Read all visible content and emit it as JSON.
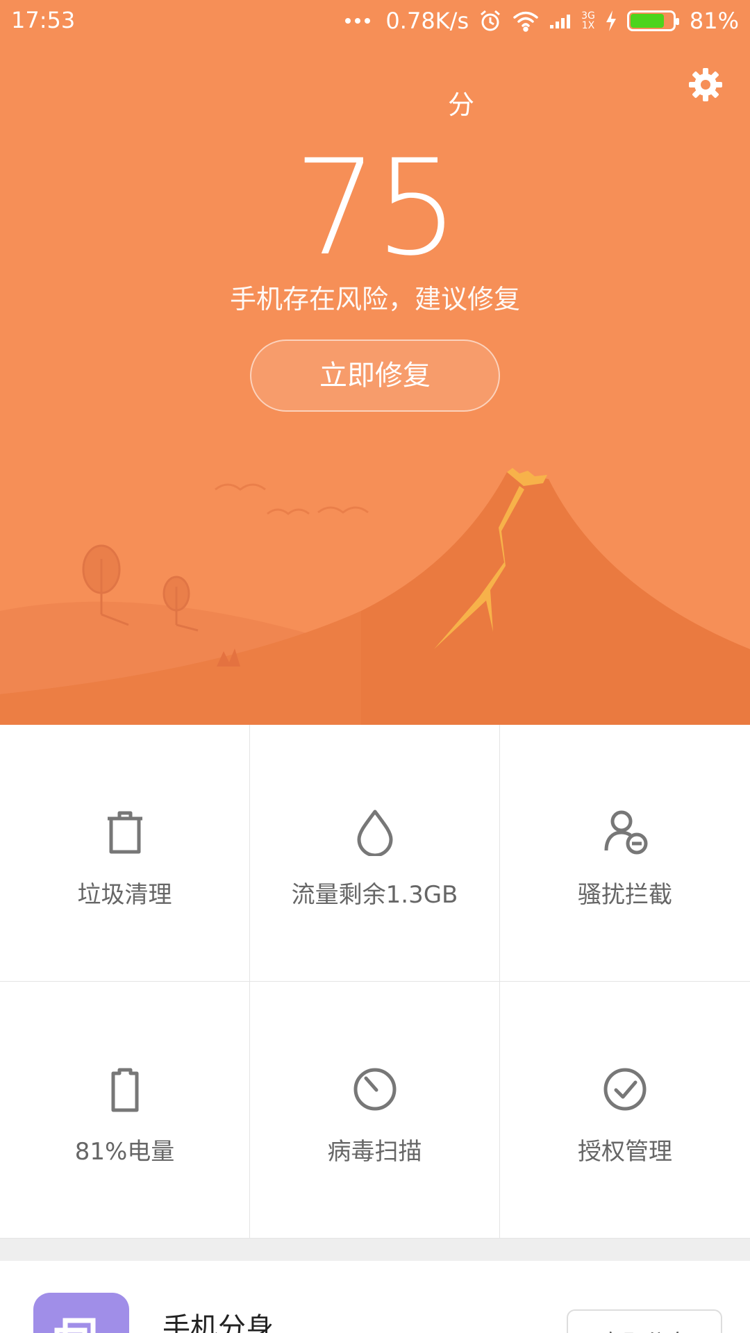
{
  "status_bar": {
    "time": "17:53",
    "net_speed": "0.78K/s",
    "net_type_top": "3G",
    "net_type_bottom": "1X",
    "battery_percent": "81%",
    "battery_level": 0.81
  },
  "hero": {
    "score": "75",
    "score_unit": "分",
    "warning": "手机存在风险，建议修复",
    "fix_button": "立即修复",
    "colors": {
      "background": "#f68f57",
      "mountain": "#ea7a40",
      "crack": "#f7b24a"
    }
  },
  "grid": {
    "items": [
      {
        "label": "垃圾清理",
        "icon": "trash-icon"
      },
      {
        "label": "流量剩余1.3GB",
        "icon": "droplet-icon"
      },
      {
        "label": "骚扰拦截",
        "icon": "block-user-icon"
      },
      {
        "label": "81%电量",
        "icon": "battery-icon"
      },
      {
        "label": "病毒扫描",
        "icon": "virus-scan-icon"
      },
      {
        "label": "授权管理",
        "icon": "check-circle-icon"
      }
    ]
  },
  "card": {
    "title": "手机分身",
    "button": "立即分身",
    "icon": "dual-app-icon"
  }
}
